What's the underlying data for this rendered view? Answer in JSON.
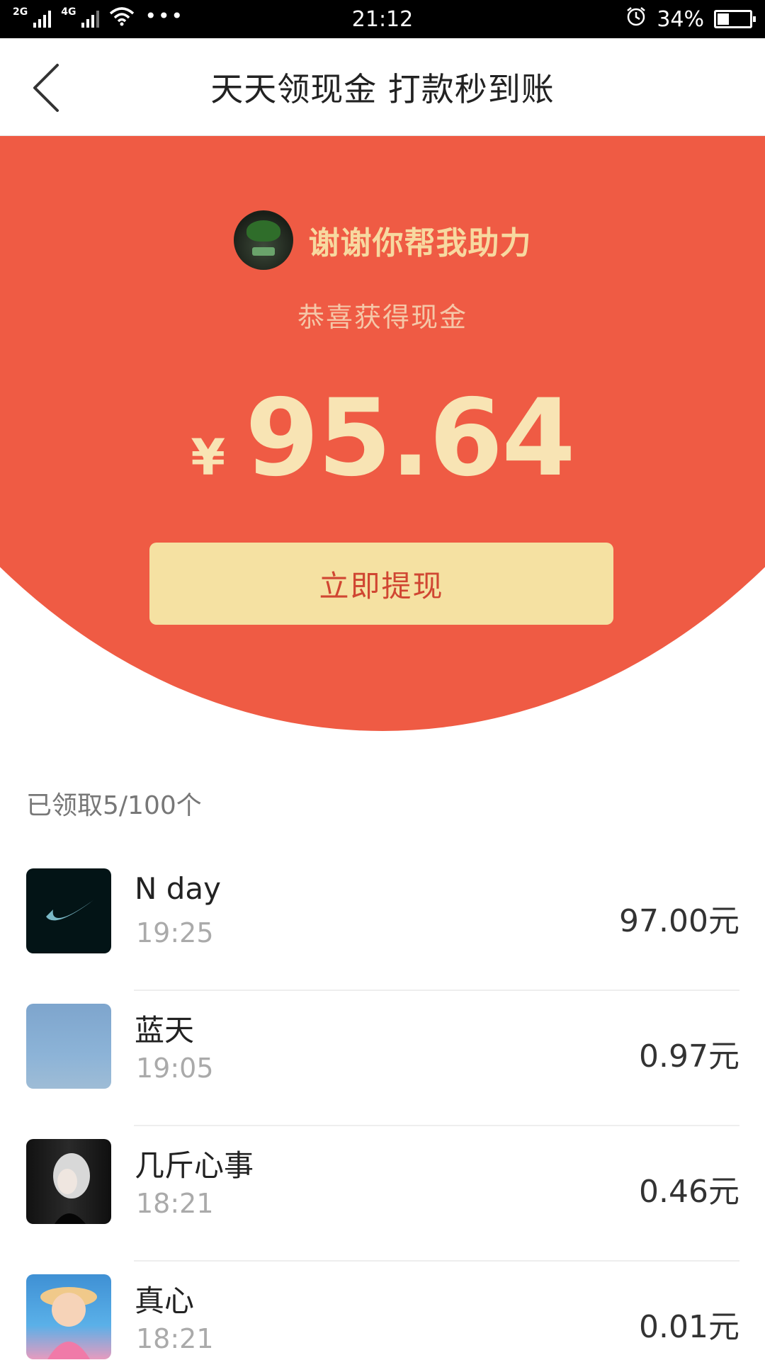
{
  "status_bar": {
    "net1": "2G",
    "net2": "4G",
    "dots": "•••",
    "time": "21:12",
    "battery_percent": "34%",
    "battery_level": 0.34
  },
  "nav": {
    "title": "天天领现金 打款秒到账"
  },
  "hero": {
    "helper_text": "谢谢你帮我助力",
    "congrats_text": "恭喜获得现金",
    "currency": "¥",
    "amount": "95.64",
    "withdraw_label": "立即提现",
    "colors": {
      "background": "#ef5b44",
      "gold": "#f8e4b4",
      "button": "#f5e1a2",
      "button_text": "#d04632"
    }
  },
  "claimed": {
    "summary": "已领取5/100个",
    "items": [
      {
        "name": "N day",
        "time": "19:25",
        "amount": "97.00元"
      },
      {
        "name": "蓝天",
        "time": "19:05",
        "amount": "0.97元"
      },
      {
        "name": "几斤心事",
        "time": "18:21",
        "amount": "0.46元"
      },
      {
        "name": "真心",
        "time": "18:21",
        "amount": "0.01元"
      }
    ]
  }
}
